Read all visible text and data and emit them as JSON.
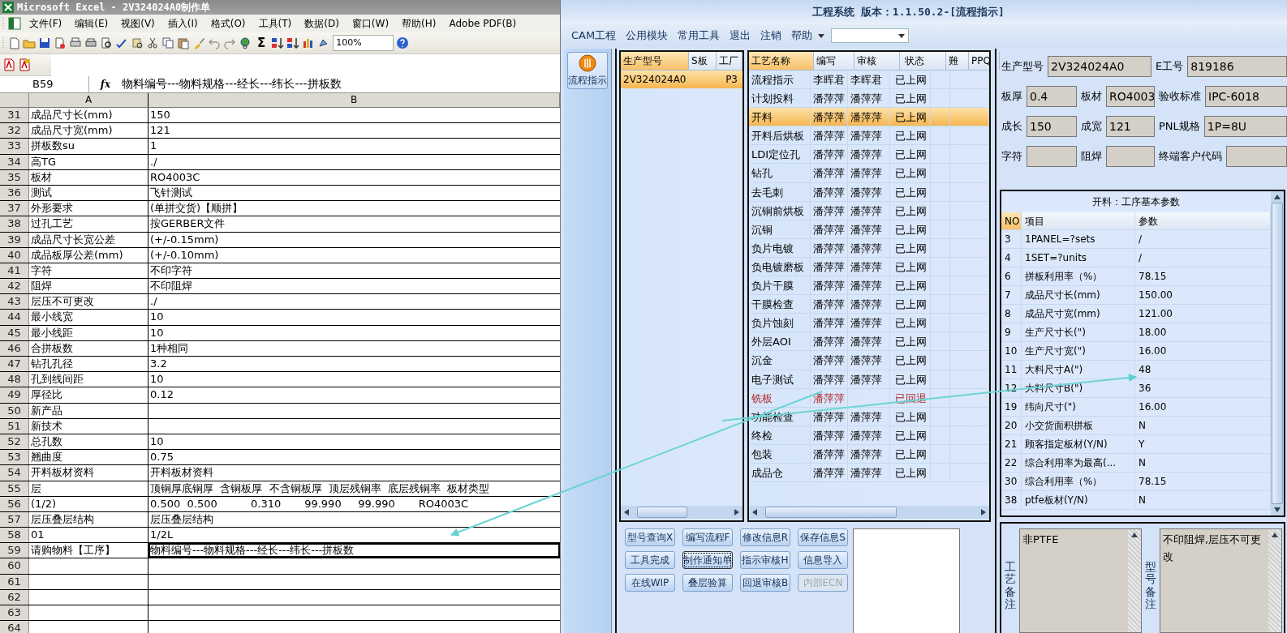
{
  "excel": {
    "title": "Microsoft Excel - 2V324024A0制作单",
    "menu": [
      "文件(F)",
      "编辑(E)",
      "视图(V)",
      "插入(I)",
      "格式(O)",
      "工具(T)",
      "数据(D)",
      "窗口(W)",
      "帮助(H)",
      "Adobe PDF(B)"
    ],
    "sum_symbol": "Σ",
    "zoom": "100%",
    "name_box": "B59",
    "fx": "fx",
    "formula": "物料编号---物料规格---经长---纬长---拼板数",
    "columns": [
      "A",
      "B"
    ],
    "rows": [
      {
        "num": "31",
        "a": "成品尺寸长(mm)",
        "b": "150"
      },
      {
        "num": "32",
        "a": "成品尺寸宽(mm)",
        "b": "121"
      },
      {
        "num": "33",
        "a": "拼板数su",
        "b": "1"
      },
      {
        "num": "34",
        "a": "高TG",
        "b": "./"
      },
      {
        "num": "35",
        "a": "板材",
        "b": "RO4003C"
      },
      {
        "num": "36",
        "a": "测试",
        "b": "飞针测试"
      },
      {
        "num": "37",
        "a": "外形要求",
        "b": "(单拼交货)【顺拼】"
      },
      {
        "num": "38",
        "a": "过孔工艺",
        "b": "按GERBER文件"
      },
      {
        "num": "39",
        "a": "成品尺寸长宽公差",
        "b": "(+/-0.15mm)"
      },
      {
        "num": "40",
        "a": "成品板厚公差(mm)",
        "b": "(+/-0.10mm)"
      },
      {
        "num": "41",
        "a": "字符",
        "b": "不印字符"
      },
      {
        "num": "42",
        "a": "阻焊",
        "b": "不印阻焊"
      },
      {
        "num": "43",
        "a": "层压不可更改",
        "b": "./"
      },
      {
        "num": "44",
        "a": "最小线宽",
        "b": "10"
      },
      {
        "num": "45",
        "a": "最小线距",
        "b": "10"
      },
      {
        "num": "46",
        "a": "合拼板数",
        "b": "1种相同"
      },
      {
        "num": "47",
        "a": "钻孔孔径",
        "b": "3.2"
      },
      {
        "num": "48",
        "a": "孔到线间距",
        "b": "10"
      },
      {
        "num": "49",
        "a": "厚径比",
        "b": "0.12"
      },
      {
        "num": "50",
        "a": "新产品"
      },
      {
        "num": "51",
        "a": "新技术"
      },
      {
        "num": "52",
        "a": "总孔数",
        "b": "10"
      },
      {
        "num": "53",
        "a": "翘曲度",
        "b": "0.75"
      },
      {
        "num": "54",
        "a": "开料板材资料",
        "b": "开料板材资料"
      },
      {
        "num": "55",
        "a": "层",
        "b": "顶铜厚底铜厚  含铜板厚  不含铜板厚  顶层残铜率  底层残铜率  板材类型"
      },
      {
        "num": "56",
        "a": "(1/2)",
        "b": "0.500  0.500          0.310       99.990     99.990       RO4003C"
      },
      {
        "num": "57",
        "a": "层压叠层结构",
        "b": "层压叠层结构"
      },
      {
        "num": "58",
        "a": "01",
        "b": "1/2L"
      },
      {
        "num": "59",
        "a": "请购物料【工序】",
        "b": "物料编号---物料规格---经长---纬长---拼板数",
        "selected": true
      },
      {
        "num": "60"
      },
      {
        "num": "61"
      },
      {
        "num": "62"
      },
      {
        "num": "63"
      },
      {
        "num": "64"
      }
    ]
  },
  "app": {
    "title": "工程系统 版本：1.1.50.2-[流程指示]",
    "menu": [
      "CAM工程",
      "公用模块",
      "常用工具",
      "退出",
      "注销",
      "帮助"
    ],
    "nav_button": "流程指示",
    "products": {
      "columns": [
        "生产型号",
        "S板",
        "工厂"
      ],
      "rows": [
        {
          "model": "2V324024A0",
          "factory": "P3",
          "selected": true
        }
      ]
    },
    "processes": {
      "columns": [
        "工艺名称",
        "编写",
        "审核",
        "状态",
        "難",
        "PPQ"
      ],
      "rows": [
        {
          "name": "流程指示",
          "writer": "李晖君",
          "reviewer": "李晖君",
          "status": "已上网",
          "selected": false,
          "returned": false
        },
        {
          "name": "计划投料",
          "writer": "潘萍萍",
          "reviewer": "潘萍萍",
          "status": "已上网",
          "selected": false,
          "returned": false
        },
        {
          "name": "开料",
          "writer": "潘萍萍",
          "reviewer": "潘萍萍",
          "status": "已上网",
          "selected": true,
          "returned": false
        },
        {
          "name": "开料后烘板",
          "writer": "潘萍萍",
          "reviewer": "潘萍萍",
          "status": "已上网",
          "selected": false,
          "returned": false
        },
        {
          "name": "LDI定位孔",
          "writer": "潘萍萍",
          "reviewer": "潘萍萍",
          "status": "已上网",
          "selected": false,
          "returned": false
        },
        {
          "name": "钻孔",
          "writer": "潘萍萍",
          "reviewer": "潘萍萍",
          "status": "已上网",
          "selected": false,
          "returned": false
        },
        {
          "name": "去毛刺",
          "writer": "潘萍萍",
          "reviewer": "潘萍萍",
          "status": "已上网",
          "selected": false,
          "returned": false
        },
        {
          "name": "沉铜前烘板",
          "writer": "潘萍萍",
          "reviewer": "潘萍萍",
          "status": "已上网",
          "selected": false,
          "returned": false
        },
        {
          "name": "沉铜",
          "writer": "潘萍萍",
          "reviewer": "潘萍萍",
          "status": "已上网",
          "selected": false,
          "returned": false
        },
        {
          "name": "负片电镀",
          "writer": "潘萍萍",
          "reviewer": "潘萍萍",
          "status": "已上网",
          "selected": false,
          "returned": false
        },
        {
          "name": "负电镀磨板",
          "writer": "潘萍萍",
          "reviewer": "潘萍萍",
          "status": "已上网",
          "selected": false,
          "returned": false
        },
        {
          "name": "负片干膜",
          "writer": "潘萍萍",
          "reviewer": "潘萍萍",
          "status": "已上网",
          "selected": false,
          "returned": false
        },
        {
          "name": "干膜检查",
          "writer": "潘萍萍",
          "reviewer": "潘萍萍",
          "status": "已上网",
          "selected": false,
          "returned": false
        },
        {
          "name": "负片蚀刻",
          "writer": "潘萍萍",
          "reviewer": "潘萍萍",
          "status": "已上网",
          "selected": false,
          "returned": false
        },
        {
          "name": "外层AOI",
          "writer": "潘萍萍",
          "reviewer": "潘萍萍",
          "status": "已上网",
          "selected": false,
          "returned": false
        },
        {
          "name": "沉金",
          "writer": "潘萍萍",
          "reviewer": "潘萍萍",
          "status": "已上网",
          "selected": false,
          "returned": false
        },
        {
          "name": "电子测试",
          "writer": "潘萍萍",
          "reviewer": "潘萍萍",
          "status": "已上网",
          "selected": false,
          "returned": false
        },
        {
          "name": "铣板",
          "writer": "潘萍萍",
          "status": "已回退",
          "selected": false,
          "returned": true
        },
        {
          "name": "功能检查",
          "writer": "潘萍萍",
          "reviewer": "潘萍萍",
          "status": "已上网",
          "selected": false,
          "returned": false
        },
        {
          "name": "终检",
          "writer": "潘萍萍",
          "reviewer": "潘萍萍",
          "status": "已上网",
          "selected": false,
          "returned": false
        },
        {
          "name": "包装",
          "writer": "潘萍萍",
          "reviewer": "潘萍萍",
          "status": "已上网",
          "selected": false,
          "returned": false
        },
        {
          "name": "成品仓",
          "writer": "潘萍萍",
          "reviewer": "潘萍萍",
          "status": "已上网",
          "selected": false,
          "returned": false
        }
      ]
    },
    "buttons": [
      {
        "label": "型号查询X",
        "disabled": false,
        "focused": false
      },
      {
        "label": "编写流程F",
        "disabled": false,
        "focused": false
      },
      {
        "label": "修改信息R",
        "disabled": false,
        "focused": false
      },
      {
        "label": "保存信息S",
        "disabled": false,
        "focused": false
      },
      {
        "label": "工具完成",
        "disabled": false,
        "focused": false
      },
      {
        "label": "制作通知单",
        "disabled": false,
        "focused": true
      },
      {
        "label": "指示审核H",
        "disabled": false,
        "focused": false
      },
      {
        "label": "信息导入",
        "disabled": false,
        "focused": false
      },
      {
        "label": "在线WIP",
        "disabled": false,
        "focused": false
      },
      {
        "label": "叠层验算",
        "disabled": false,
        "focused": false
      },
      {
        "label": "回退审核B",
        "disabled": false,
        "focused": false
      },
      {
        "label": "内部ECN",
        "disabled": true,
        "focused": false
      }
    ],
    "info": [
      [
        {
          "label": "生产型号",
          "value": "2V324024A0"
        },
        {
          "label": "E工号",
          "value": "819186"
        }
      ],
      [
        {
          "label": "板厚",
          "value": "0.4"
        },
        {
          "label": "板材",
          "value": "RO4003"
        },
        {
          "label": "验收标准",
          "value": "IPC-6018"
        }
      ],
      [
        {
          "label": "成长",
          "value": "150"
        },
        {
          "label": "成宽",
          "value": "121"
        },
        {
          "label": "PNL规格",
          "value": "1P=8U"
        }
      ],
      [
        {
          "label": "字符"
        },
        {
          "label": "阻焊"
        },
        {
          "label": "终端客户代码"
        }
      ]
    ],
    "params": {
      "title": "开料：工序基本参数",
      "columns": [
        "NO",
        "项目",
        "参数"
      ],
      "rows": [
        {
          "no": "3",
          "item": "1PANEL=?sets",
          "value": "/"
        },
        {
          "no": "4",
          "item": "1SET=?units",
          "value": "/"
        },
        {
          "no": "6",
          "item": "拼板利用率（%）",
          "value": "78.15"
        },
        {
          "no": "7",
          "item": "成品尺寸长(mm)",
          "value": "150.00"
        },
        {
          "no": "8",
          "item": "成品尺寸宽(mm)",
          "value": "121.00"
        },
        {
          "no": "9",
          "item": "生产尺寸长(\")",
          "value": "18.00"
        },
        {
          "no": "10",
          "item": "生产尺寸宽(\")",
          "value": "16.00"
        },
        {
          "no": "11",
          "item": "大料尺寸A(\")",
          "value": "48"
        },
        {
          "no": "12",
          "item": "大料尺寸B(\")",
          "value": "36"
        },
        {
          "no": "19",
          "item": "纬向尺寸(\")",
          "value": "16.00"
        },
        {
          "no": "20",
          "item": "小交货面积拼板",
          "value": "N"
        },
        {
          "no": "21",
          "item": "顾客指定板材(Y/N)",
          "value": "Y"
        },
        {
          "no": "22",
          "item": "综合利用率为最高(...",
          "value": "N"
        },
        {
          "no": "30",
          "item": "综合利用率（%）",
          "value": "78.15"
        },
        {
          "no": "38",
          "item": "ptfe板材(Y/N)",
          "value": "N"
        }
      ]
    },
    "notes": [
      {
        "label": "工艺备注",
        "text": "非PTFE"
      },
      {
        "label": "型号备注",
        "text": "不印阻焊,层压不可更改"
      }
    ]
  }
}
